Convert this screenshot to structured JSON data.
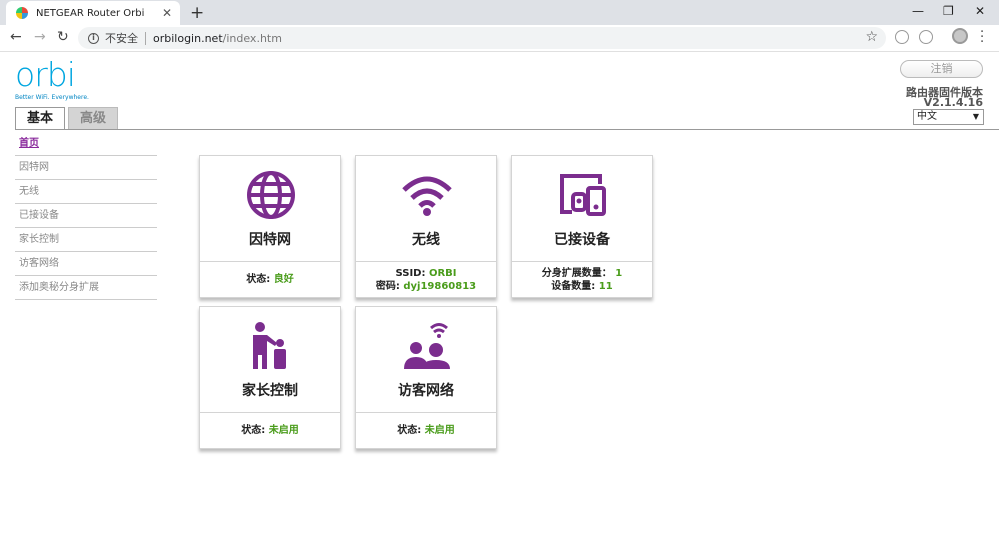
{
  "browser": {
    "tab_title": "NETGEAR Router Orbi",
    "url_insecure": "不安全",
    "url_host": "orbilogin.net",
    "url_path": "/index.htm"
  },
  "header": {
    "logo_text": "orbi",
    "logo_tagline": "Better WiFi. Everywhere.",
    "logout_label": "注销",
    "firmware_label": "路由器固件版本",
    "firmware_version": "V2.1.4.16",
    "language": "中文",
    "tabs": [
      {
        "label": "基本",
        "active": true
      },
      {
        "label": "高级",
        "active": false
      }
    ]
  },
  "sidebar": {
    "items": [
      {
        "label": "首页",
        "active": true
      },
      {
        "label": "因特网"
      },
      {
        "label": "无线"
      },
      {
        "label": "已接设备"
      },
      {
        "label": "家长控制"
      },
      {
        "label": "访客网络"
      },
      {
        "label": "添加奥秘分身扩展"
      }
    ]
  },
  "cards": {
    "internet": {
      "title": "因特网",
      "status_label": "状态:",
      "status_value": "良好"
    },
    "wireless": {
      "title": "无线",
      "ssid_label": "SSID:",
      "ssid_value": "ORBI",
      "pwd_label": "密码:",
      "pwd_value": "dyj19860813"
    },
    "devices": {
      "title": "已接设备",
      "sat_label": "分身扩展数量：",
      "sat_value": "1",
      "dev_label": "设备数量:",
      "dev_value": "11"
    },
    "parental": {
      "title": "家长控制",
      "status_label": "状态:",
      "status_value": "未启用"
    },
    "guest": {
      "title": "访客网络",
      "status_label": "状态:",
      "status_value": "未启用"
    }
  },
  "colors": {
    "accent": "#7b2d8e",
    "status_green": "#4a9c1b",
    "logo_blue": "#00a6e0"
  }
}
